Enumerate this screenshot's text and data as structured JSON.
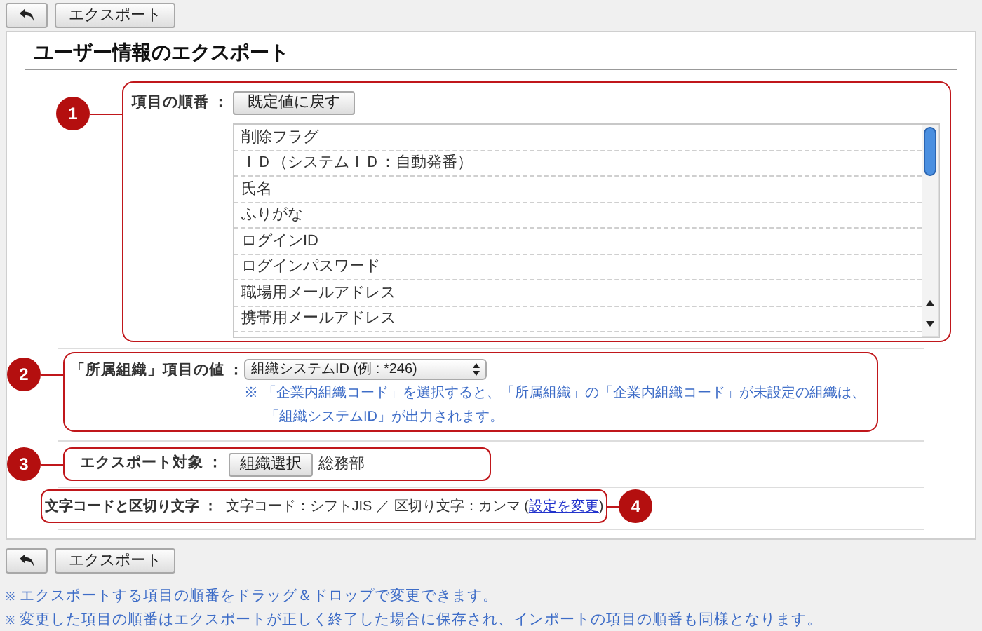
{
  "top_toolbar": {
    "export_button": "エクスポート"
  },
  "title": "ユーザー情報のエクスポート",
  "item_order": {
    "number": "1",
    "label": "項目の順番 ：",
    "reset_button": "既定値に戻す",
    "items": [
      "削除フラグ",
      "ＩＤ（システムＩＤ：自動発番）",
      "氏名",
      "ふりがな",
      "ログインID",
      "ログインパスワード",
      "職場用メールアドレス",
      "携帯用メールアドレス"
    ]
  },
  "organization_value": {
    "number": "2",
    "label": "「所属組織」項目の値 ：",
    "select": {
      "value": "組織システムID (例 : *246)"
    },
    "note_lines": [
      "※ 「企業内組織コード」を選択すると、「所属組織」の「企業内組織コード」が未設定の組織は、",
      "「組織システムID」が出力されます。"
    ]
  },
  "export_target": {
    "number": "3",
    "label": "エクスポート対象 ：",
    "select_button": "組織選択",
    "value": "総務部"
  },
  "encoding": {
    "number": "4",
    "label": "文字コードと区切り文字 ：",
    "value": "文字コード：シフトJIS ／ 区切り文字：カンマ (",
    "link": "設定を変更",
    "suffix": ")"
  },
  "bottom_toolbar": {
    "export_button": "エクスポート"
  },
  "footnote_marks": [
    "※",
    "※"
  ],
  "footnotes": [
    "エクスポートする項目の順番をドラッグ＆ドロップで変更できます。",
    "変更した項目の順番はエクスポートが正しく終了した場合に保存され、インポートの項目の順番も同様となります。"
  ]
}
